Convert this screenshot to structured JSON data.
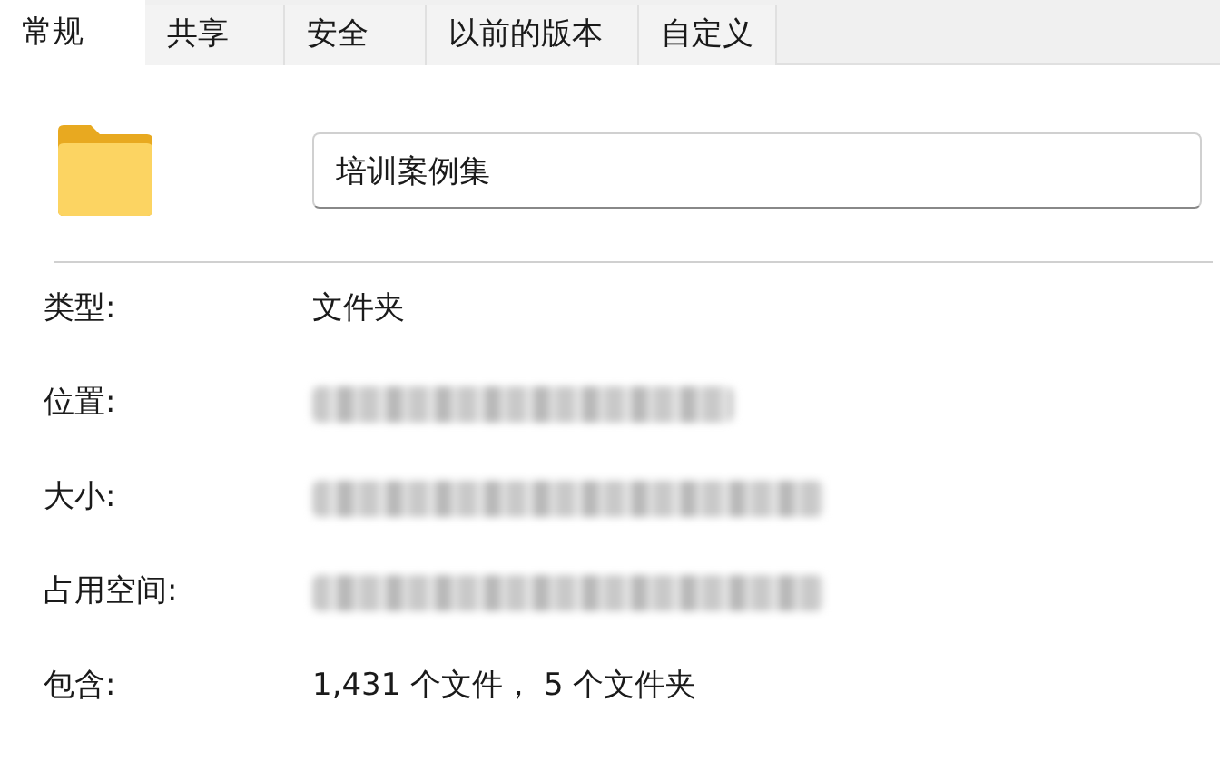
{
  "tabs": [
    {
      "label": "常规",
      "selected": true
    },
    {
      "label": "共享",
      "selected": false
    },
    {
      "label": "安全",
      "selected": false
    },
    {
      "label": "以前的版本",
      "selected": false
    },
    {
      "label": "自定义",
      "selected": false
    }
  ],
  "name_field": {
    "value": "培训案例集"
  },
  "properties": [
    {
      "label": "类型:",
      "kind": "text",
      "value": "文件夹"
    },
    {
      "label": "位置:",
      "kind": "redacted"
    },
    {
      "label": "大小:",
      "kind": "redacted"
    },
    {
      "label": "占用空间:",
      "kind": "redacted"
    },
    {
      "label": "包含:",
      "kind": "text",
      "value": "1,431 个文件， 5 个文件夹"
    }
  ]
}
